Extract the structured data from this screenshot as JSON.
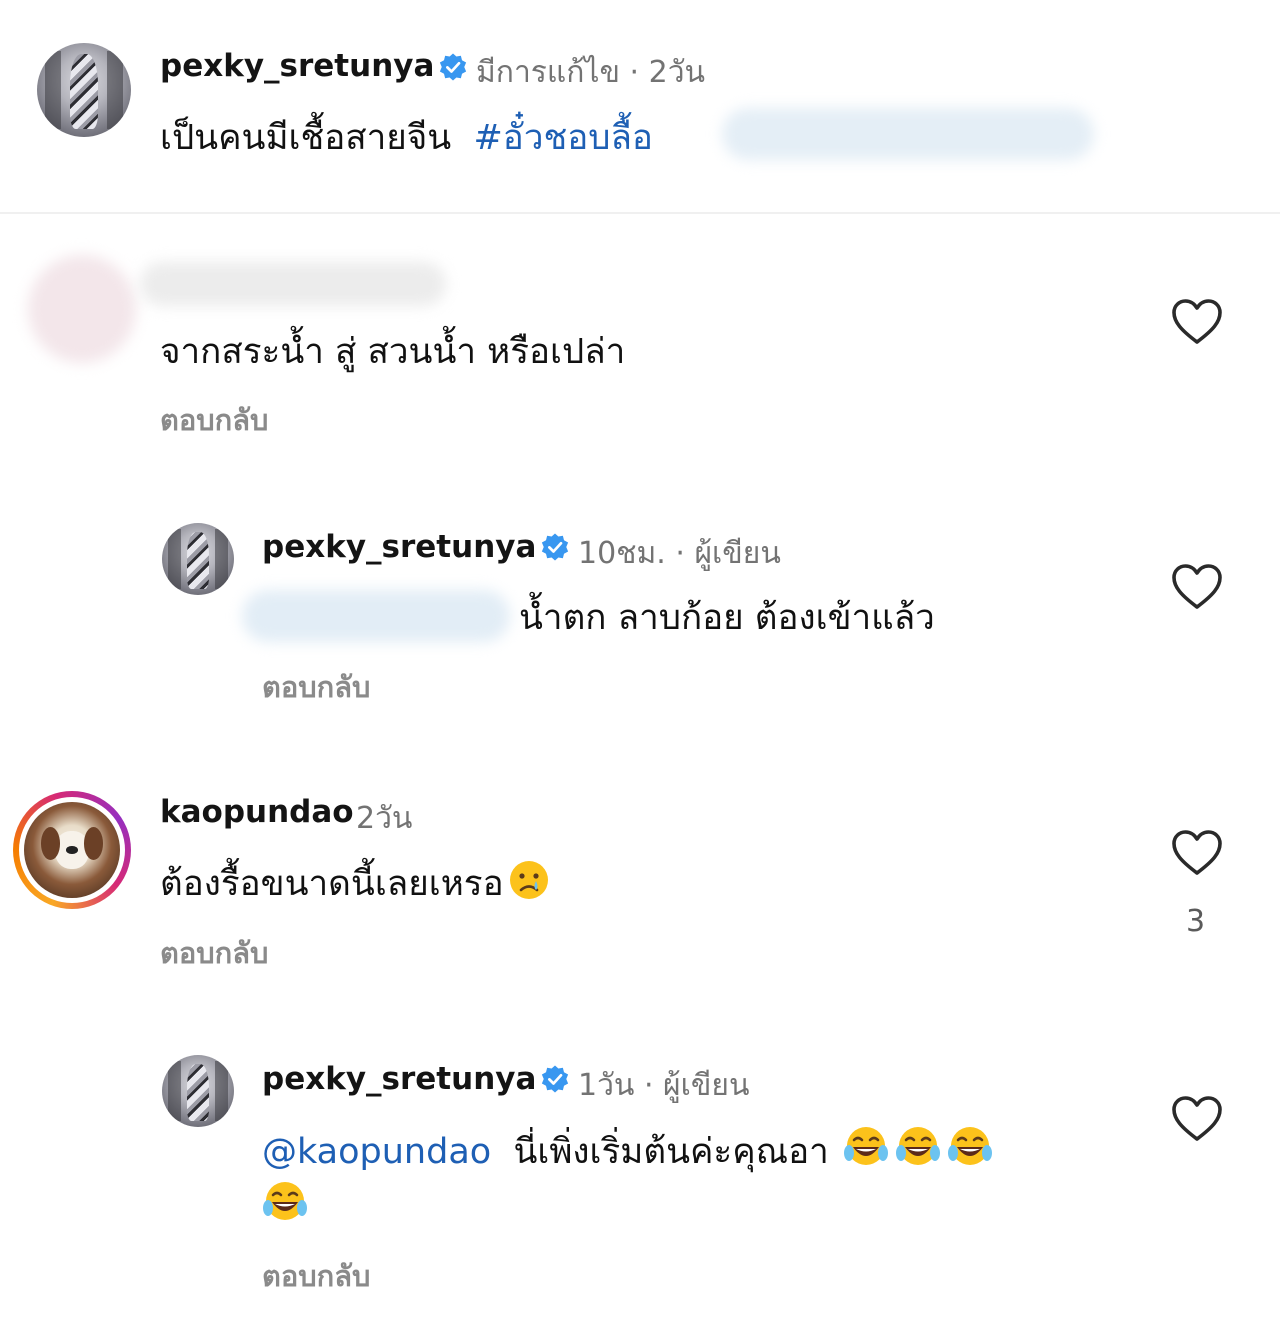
{
  "post": {
    "username": "pexky_sretunya",
    "meta": "มีการแก้ไข · 2วัน",
    "caption": "เป็นคนมีเชื้อสายจีน",
    "hashtag": "#อั๋วชอบลื้อ"
  },
  "comments": [
    {
      "text": "จากสระน้ำ สู่ สวนน้ำ หรือเปล่า",
      "reply_label": "ตอบกลับ"
    },
    {
      "username": "pexky_sretunya",
      "meta": "10ชม. · ผู้เขียน",
      "text": "น้ำตก  ลาบก้อย ต้องเข้าแล้ว",
      "reply_label": "ตอบกลับ"
    },
    {
      "username": "kaopundao",
      "meta": "2วัน",
      "text": "ต้องรื้อขนาดนี้เลยเหรอ",
      "reply_label": "ตอบกลับ",
      "like_count": "3"
    },
    {
      "username": "pexky_sretunya",
      "meta": "1วัน · ผู้เขียน",
      "mention": "@kaopundao",
      "text": "นี่เพิ่งเริ่มต้นค่ะคุณอา",
      "reply_label": "ตอบกลับ"
    }
  ],
  "icons": {
    "verified": "verified-badge-icon",
    "like": "heart-outline-icon",
    "cry": "crying-face-emoji",
    "laugh": "tears-of-joy-emoji"
  },
  "colors": {
    "verified_blue": "#3897f0",
    "link_blue": "#1e5fb4",
    "meta_gray": "#737373",
    "story_ring_start": "#f9a825",
    "story_ring_end": "#d62976"
  }
}
